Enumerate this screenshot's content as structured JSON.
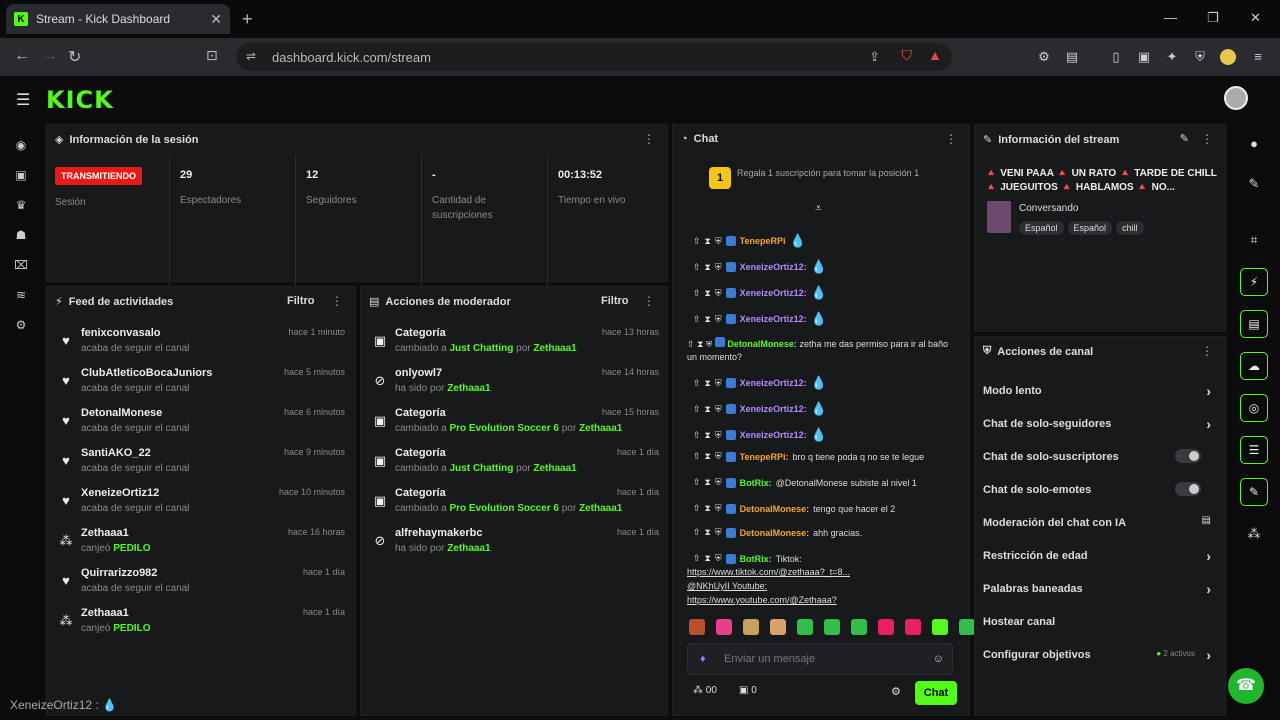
{
  "browser": {
    "tab_title": "Stream - Kick Dashboard",
    "url": "dashboard.kick.com/stream",
    "favicon_letter": "K"
  },
  "app": {
    "logo": "KICK"
  },
  "session": {
    "title": "Información de la sesión",
    "live_badge": "TRANSMITIENDO",
    "session_label": "Sesión",
    "stats": [
      {
        "value": "29",
        "label": "Espectadores"
      },
      {
        "value": "12",
        "label": "Seguidores"
      },
      {
        "value": "-",
        "label": "Cantidad de suscripciones"
      },
      {
        "value": "00:13:52",
        "label": "Tiempo en vivo"
      }
    ]
  },
  "activity": {
    "title": "Feed de actividades",
    "filter": "Filtro",
    "items": [
      {
        "name": "fenixconvasalo",
        "desc": "acaba de seguir el canal",
        "time": "hace 1 minuto",
        "icon": "heart-icon"
      },
      {
        "name": "ClubAtleticoBocaJuniors",
        "desc": "acaba de seguir el canal",
        "time": "hace 5 minutos",
        "icon": "heart-icon"
      },
      {
        "name": "DetonalMonese",
        "desc": "acaba de seguir el canal",
        "time": "hace 6 minutos",
        "icon": "heart-icon"
      },
      {
        "name": "SantiAKO_22",
        "desc": "acaba de seguir el canal",
        "time": "hace 9 minutos",
        "icon": "heart-icon"
      },
      {
        "name": "XeneizeOrtiz12",
        "desc": "acaba de seguir el canal",
        "time": "hace 10 minutos",
        "icon": "heart-icon"
      },
      {
        "name": "Zethaaa1",
        "desc_prefix": "canjeó",
        "desc_highlight": "PEDILO",
        "time": "hace 16 horas",
        "icon": "gift-icon"
      },
      {
        "name": "Quirrarizzo982",
        "desc": "acaba de seguir el canal",
        "time": "hace 1 día",
        "icon": "heart-icon"
      },
      {
        "name": "Zethaaa1",
        "desc_prefix": "canjeó",
        "desc_highlight": "PEDILO",
        "time": "hace 1 día",
        "icon": "gift-icon"
      }
    ]
  },
  "modactions": {
    "title": "Acciones de moderador",
    "filter": "Filtro",
    "items": [
      {
        "name": "Categoría",
        "prefix": "cambiado a",
        "hl1": "Just Chatting",
        "mid": "por",
        "hl2": "Zethaaa1",
        "time": "hace 13 horas"
      },
      {
        "name": "onlyowl7",
        "prefix": "ha sido",
        "hl1": "",
        "mid": "por",
        "hl2": "Zethaaa1",
        "time": "hace 14 horas"
      },
      {
        "name": "Categoría",
        "prefix": "cambiado a",
        "hl1": "Pro Evolution Soccer 6",
        "mid": "por",
        "hl2": "Zethaaa1",
        "time": "hace 15 horas"
      },
      {
        "name": "Categoría",
        "prefix": "cambiado a",
        "hl1": "Just Chatting",
        "mid": "por",
        "hl2": "Zethaaa1",
        "time": "hace 1 día"
      },
      {
        "name": "Categoría",
        "prefix": "cambiado a",
        "hl1": "Pro Evolution Soccer 6",
        "mid": "por",
        "hl2": "Zethaaa1",
        "time": "hace 1 día"
      },
      {
        "name": "alfrehaymakerbc",
        "prefix": "ha sido",
        "hl1": "",
        "mid": "por",
        "hl2": "Zethaaa1",
        "time": "hace 1 día"
      }
    ]
  },
  "chat": {
    "title": "Chat",
    "gift_promo": "Regala 1 suscripción para tomar la posición 1",
    "messages": [
      {
        "user": "TenepeRPi",
        "text": "",
        "color": "#f5a623"
      },
      {
        "user": "XeneizeOrtiz12:",
        "text": "",
        "color": "#b38cff"
      },
      {
        "user": "XeneizeOrtiz12:",
        "text": "",
        "color": "#b38cff"
      },
      {
        "user": "XeneizeOrtiz12:",
        "text": "",
        "color": "#b38cff"
      },
      {
        "user": "DetonalMonese:",
        "text": "zetha me das permiso para ir al baño un momento?",
        "color": "#53fc18"
      },
      {
        "user": "XeneizeOrtiz12:",
        "text": "",
        "color": "#b38cff"
      },
      {
        "user": "XeneizeOrtiz12:",
        "text": "",
        "color": "#b38cff"
      },
      {
        "user": "XeneizeOrtiz12:",
        "text": "",
        "color": "#b38cff"
      },
      {
        "user": "TenepeRPi:",
        "text": "bro q tiene poda q no se te legue",
        "color": "#f5a623"
      },
      {
        "user": "BotRix:",
        "text": "@DetonalMonese subiste al nivel 1",
        "color": "#53fc18"
      },
      {
        "user": "DetonalMonese:",
        "text": "tengo que hacer el 2",
        "color": "#f5a623"
      },
      {
        "user": "DetonalMonese:",
        "text": "ahh gracias.",
        "color": "#f5a623"
      },
      {
        "user": "BotRix:",
        "text": "Tiktok:",
        "color": "#53fc18"
      }
    ],
    "links": [
      "https://www.tiktok.com/@zethaaa?_t=8...",
      "@NKhUyII Youtube:",
      "https://www.youtube.com/@Zethaaa?"
    ],
    "input_placeholder": "Enviar un mensaje",
    "points": "00",
    "count": "0",
    "send_label": "Chat"
  },
  "streaminfo": {
    "title": "Información del stream",
    "stream_title": "🔺 VENI PAAA 🔺 UN RATO 🔺 TARDE DE CHILL 🔺 JUEGUITOS 🔺 HABLAMOS 🔺 NO...",
    "category": "Conversando",
    "tags": [
      "Español",
      "Español",
      "chill"
    ]
  },
  "channelactions": {
    "title": "Acciones de canal",
    "rows": [
      {
        "label": "Modo lento",
        "control": "chevron"
      },
      {
        "label": "Chat de solo-seguidores",
        "control": "chevron"
      },
      {
        "label": "Chat de solo-suscriptores",
        "control": "toggle"
      },
      {
        "label": "Chat de solo-emotes",
        "control": "toggle"
      },
      {
        "label": "Moderación del chat con IA",
        "control": "icon"
      },
      {
        "label": "Restricción de edad",
        "control": "chevron"
      },
      {
        "label": "Palabras baneadas",
        "control": "chevron"
      },
      {
        "label": "Hostear canal",
        "control": "none"
      },
      {
        "label": "Configurar objetivos",
        "control": "chevron",
        "extra": "2 activos"
      }
    ]
  },
  "footer_user": "XeneizeOrtiz12 :"
}
